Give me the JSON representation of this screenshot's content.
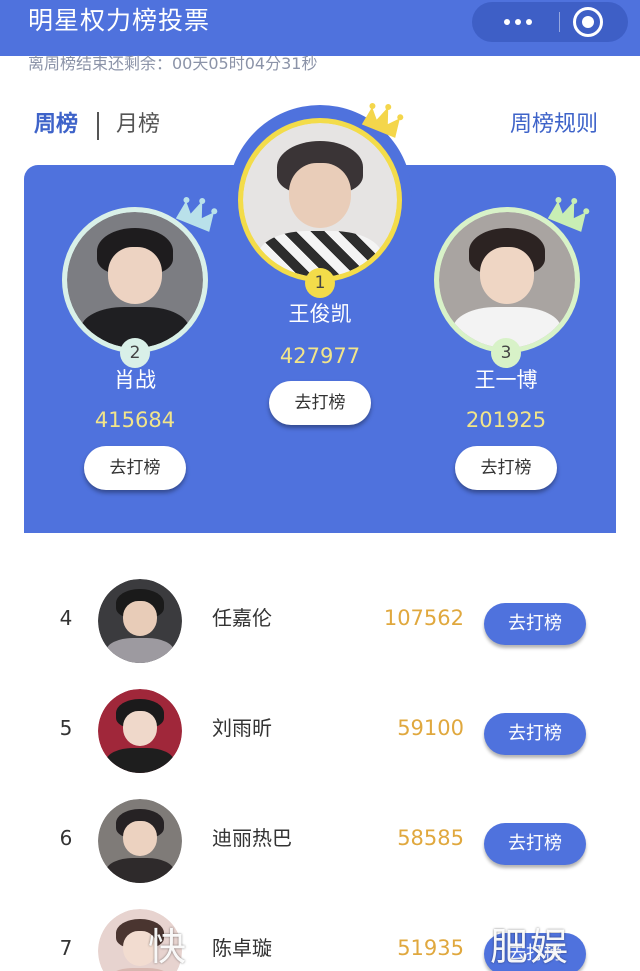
{
  "header": {
    "title": "明星权力榜投票",
    "more_icon": "more-dots-icon",
    "close_icon": "target-close-icon"
  },
  "countdown": "离周榜结束还剩余：00天05时04分31秒",
  "tabs": [
    {
      "label": "周榜",
      "active": true
    },
    {
      "label": "月榜",
      "active": false
    }
  ],
  "rules_link": "周榜规则",
  "colors": {
    "primary": "#4f72dd",
    "gold": "#f2e58a",
    "votes_orange": "#e0a83e",
    "first_ring": "#f3dc4a",
    "second_ring": "#d9f0e8",
    "third_ring": "#d8f2c8"
  },
  "podium": [
    {
      "rank": "1",
      "name": "王俊凯",
      "votes": "427977",
      "button": "去打榜"
    },
    {
      "rank": "2",
      "name": "肖战",
      "votes": "415684",
      "button": "去打榜"
    },
    {
      "rank": "3",
      "name": "王一博",
      "votes": "201925",
      "button": "去打榜"
    }
  ],
  "list": [
    {
      "rank": "4",
      "name": "任嘉伦",
      "votes": "107562",
      "button": "去打榜"
    },
    {
      "rank": "5",
      "name": "刘雨昕",
      "votes": "59100",
      "button": "去打榜"
    },
    {
      "rank": "6",
      "name": "迪丽热巴",
      "votes": "58585",
      "button": "去打榜"
    },
    {
      "rank": "7",
      "name": "陈卓璇",
      "votes": "51935",
      "button": "去打榜"
    }
  ],
  "watermark": {
    "left": "快",
    "right": "肥娱"
  }
}
